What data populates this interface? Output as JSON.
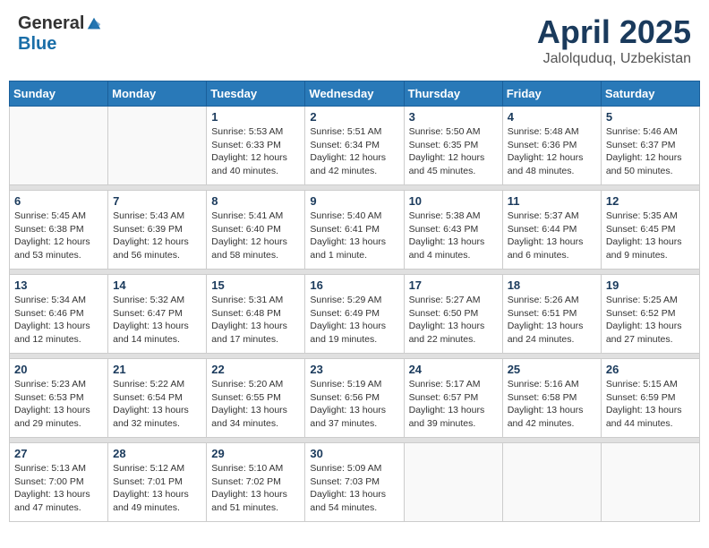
{
  "header": {
    "logo_general": "General",
    "logo_blue": "Blue",
    "month_title": "April 2025",
    "location": "Jalolquduq, Uzbekistan"
  },
  "weekdays": [
    "Sunday",
    "Monday",
    "Tuesday",
    "Wednesday",
    "Thursday",
    "Friday",
    "Saturday"
  ],
  "weeks": [
    [
      {
        "day": null
      },
      {
        "day": null
      },
      {
        "day": "1",
        "sunrise": "5:53 AM",
        "sunset": "6:33 PM",
        "daylight": "12 hours and 40 minutes."
      },
      {
        "day": "2",
        "sunrise": "5:51 AM",
        "sunset": "6:34 PM",
        "daylight": "12 hours and 42 minutes."
      },
      {
        "day": "3",
        "sunrise": "5:50 AM",
        "sunset": "6:35 PM",
        "daylight": "12 hours and 45 minutes."
      },
      {
        "day": "4",
        "sunrise": "5:48 AM",
        "sunset": "6:36 PM",
        "daylight": "12 hours and 48 minutes."
      },
      {
        "day": "5",
        "sunrise": "5:46 AM",
        "sunset": "6:37 PM",
        "daylight": "12 hours and 50 minutes."
      }
    ],
    [
      {
        "day": "6",
        "sunrise": "5:45 AM",
        "sunset": "6:38 PM",
        "daylight": "12 hours and 53 minutes."
      },
      {
        "day": "7",
        "sunrise": "5:43 AM",
        "sunset": "6:39 PM",
        "daylight": "12 hours and 56 minutes."
      },
      {
        "day": "8",
        "sunrise": "5:41 AM",
        "sunset": "6:40 PM",
        "daylight": "12 hours and 58 minutes."
      },
      {
        "day": "9",
        "sunrise": "5:40 AM",
        "sunset": "6:41 PM",
        "daylight": "13 hours and 1 minute."
      },
      {
        "day": "10",
        "sunrise": "5:38 AM",
        "sunset": "6:43 PM",
        "daylight": "13 hours and 4 minutes."
      },
      {
        "day": "11",
        "sunrise": "5:37 AM",
        "sunset": "6:44 PM",
        "daylight": "13 hours and 6 minutes."
      },
      {
        "day": "12",
        "sunrise": "5:35 AM",
        "sunset": "6:45 PM",
        "daylight": "13 hours and 9 minutes."
      }
    ],
    [
      {
        "day": "13",
        "sunrise": "5:34 AM",
        "sunset": "6:46 PM",
        "daylight": "13 hours and 12 minutes."
      },
      {
        "day": "14",
        "sunrise": "5:32 AM",
        "sunset": "6:47 PM",
        "daylight": "13 hours and 14 minutes."
      },
      {
        "day": "15",
        "sunrise": "5:31 AM",
        "sunset": "6:48 PM",
        "daylight": "13 hours and 17 minutes."
      },
      {
        "day": "16",
        "sunrise": "5:29 AM",
        "sunset": "6:49 PM",
        "daylight": "13 hours and 19 minutes."
      },
      {
        "day": "17",
        "sunrise": "5:27 AM",
        "sunset": "6:50 PM",
        "daylight": "13 hours and 22 minutes."
      },
      {
        "day": "18",
        "sunrise": "5:26 AM",
        "sunset": "6:51 PM",
        "daylight": "13 hours and 24 minutes."
      },
      {
        "day": "19",
        "sunrise": "5:25 AM",
        "sunset": "6:52 PM",
        "daylight": "13 hours and 27 minutes."
      }
    ],
    [
      {
        "day": "20",
        "sunrise": "5:23 AM",
        "sunset": "6:53 PM",
        "daylight": "13 hours and 29 minutes."
      },
      {
        "day": "21",
        "sunrise": "5:22 AM",
        "sunset": "6:54 PM",
        "daylight": "13 hours and 32 minutes."
      },
      {
        "day": "22",
        "sunrise": "5:20 AM",
        "sunset": "6:55 PM",
        "daylight": "13 hours and 34 minutes."
      },
      {
        "day": "23",
        "sunrise": "5:19 AM",
        "sunset": "6:56 PM",
        "daylight": "13 hours and 37 minutes."
      },
      {
        "day": "24",
        "sunrise": "5:17 AM",
        "sunset": "6:57 PM",
        "daylight": "13 hours and 39 minutes."
      },
      {
        "day": "25",
        "sunrise": "5:16 AM",
        "sunset": "6:58 PM",
        "daylight": "13 hours and 42 minutes."
      },
      {
        "day": "26",
        "sunrise": "5:15 AM",
        "sunset": "6:59 PM",
        "daylight": "13 hours and 44 minutes."
      }
    ],
    [
      {
        "day": "27",
        "sunrise": "5:13 AM",
        "sunset": "7:00 PM",
        "daylight": "13 hours and 47 minutes."
      },
      {
        "day": "28",
        "sunrise": "5:12 AM",
        "sunset": "7:01 PM",
        "daylight": "13 hours and 49 minutes."
      },
      {
        "day": "29",
        "sunrise": "5:10 AM",
        "sunset": "7:02 PM",
        "daylight": "13 hours and 51 minutes."
      },
      {
        "day": "30",
        "sunrise": "5:09 AM",
        "sunset": "7:03 PM",
        "daylight": "13 hours and 54 minutes."
      },
      {
        "day": null
      },
      {
        "day": null
      },
      {
        "day": null
      }
    ]
  ],
  "labels": {
    "sunrise_prefix": "Sunrise: ",
    "sunset_prefix": "Sunset: ",
    "daylight_prefix": "Daylight: "
  }
}
